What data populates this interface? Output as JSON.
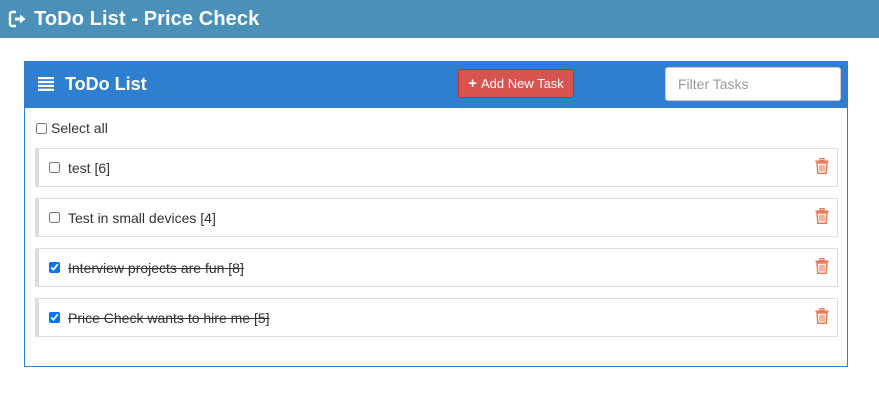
{
  "app": {
    "title": "ToDo List - Price Check"
  },
  "panel": {
    "title": "ToDo List",
    "add_button_label": "Add New Task",
    "filter_placeholder": "Filter Tasks"
  },
  "select_all": {
    "label": "Select all",
    "checked": false
  },
  "tasks": [
    {
      "label": "test [6]",
      "done": false
    },
    {
      "label": "Test in small devices [4]",
      "done": false
    },
    {
      "label": "Interview projects are fun [8]",
      "done": true
    },
    {
      "label": "Price Check wants to hire me [5]",
      "done": true
    }
  ],
  "colors": {
    "topbar": "#4a90b8",
    "panel_header": "#2f7fd0",
    "add_button": "#d9534f",
    "trash_icon": "#e8754e"
  },
  "icons": {
    "topbar": "logout-icon",
    "panel": "list-icon",
    "add": "plus-icon",
    "delete": "trash-icon"
  }
}
